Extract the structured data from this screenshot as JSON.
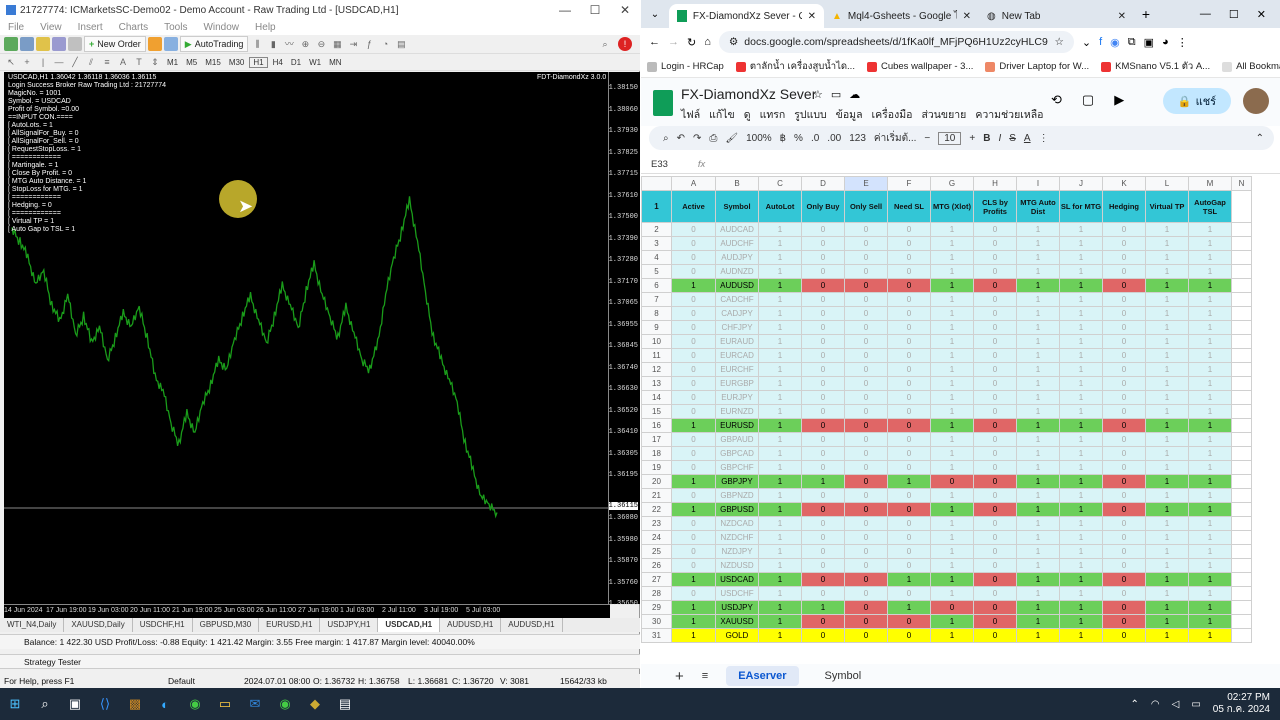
{
  "mt4": {
    "title": "21727774: ICMarketsSC-Demo02 - Demo Account - Raw Trading Ltd - [USDCAD,H1]",
    "menu": [
      "File",
      "View",
      "Insert",
      "Charts",
      "Tools",
      "Window",
      "Help"
    ],
    "toolbar": {
      "new_order": "New Order",
      "autotrading": "AutoTrading"
    },
    "timeframes": [
      "M1",
      "M5",
      "M15",
      "M30",
      "H1",
      "H4",
      "D1",
      "W1",
      "MN"
    ],
    "chart_header": "USDCAD,H1  1.36042 1.36118 1.36036 1.36115",
    "ea_name": "FDT-DiamondXz 3.0.0",
    "info_lines": [
      "Login Success Broker Raw Trading Ltd : 21727774",
      "MagicNo. = 1001",
      "Symbol. = USDCAD",
      "Profit of Symbol. =0.00",
      "==INPUT CON.====",
      "[ AutoLots. = 1",
      "[ AllSignalFor_Buy. = 0",
      "[ AllSignalFor_Sell. = 0",
      "[ RequestStopLoss. = 1",
      "[ ============",
      "[ Martingale. = 1",
      "[ Close By Profit. = 0",
      "[ MTG Auto Distance. = 1",
      "[ StopLoss for MTG. = 1",
      "[ ============",
      "[ Hedging. = 0",
      "[ ============",
      "[ Virtual TP = 1",
      "[ Auto Gap to TSL = 1"
    ],
    "price_labels": [
      "1.38150",
      "1.38060",
      "1.37930",
      "1.37825",
      "1.37715",
      "1.37610",
      "1.37500",
      "1.37390",
      "1.37280",
      "1.37170",
      "1.37065",
      "1.36955",
      "1.36845",
      "1.36740",
      "1.36630",
      "1.36520",
      "1.36410",
      "1.36305",
      "1.36195",
      "1.36115",
      "1.36080",
      "1.35980",
      "1.35870",
      "1.35760",
      "1.35650"
    ],
    "current_price": "1.36115",
    "time_labels": [
      "14 Jun 2024",
      "17 Jun 19:00",
      "19 Jun 03:00",
      "20 Jun 11:00",
      "21 Jun 19:00",
      "25 Jun 03:00",
      "26 Jun 11:00",
      "27 Jun 19:00",
      "1 Jul 03:00",
      "2 Jul 11:00",
      "3 Jul 19:00",
      "5 Jul 03:00"
    ],
    "chart_tabs": [
      "WTI_N4,Daily",
      "XAUUSD,Daily",
      "USDCHF,H1",
      "GBPUSD,M30",
      "EURUSD,H1",
      "USDJPY,H1",
      "USDCAD,H1",
      "AUDUSD,H1",
      "AUDUSD,H1"
    ],
    "active_tab": "USDCAD,H1",
    "terminal_line": "Balance: 1 422.30 USD  Profit/Loss: -0.88  Equity: 1 421.42  Margin: 3.55  Free margin: 1 417.87  Margin level: 40040.00%",
    "strategy_tester": "Strategy Tester",
    "status": {
      "help": "For Help, press F1",
      "profile": "Default",
      "datetime": "2024.07.01 08:00",
      "open": "O: 1.36732",
      "high": "H: 1.36758",
      "low": "L: 1.36681",
      "close": "C: 1.36720",
      "volume": "V: 3081",
      "traffic": "15642/33 kb"
    },
    "chart_series": [
      1.3742,
      1.3735,
      1.3728,
      1.3715,
      1.3722,
      1.3705,
      1.3698,
      1.371,
      1.3692,
      1.37,
      1.3688,
      1.3695,
      1.368,
      1.369,
      1.3702,
      1.3695,
      1.3705,
      1.369,
      1.3672,
      1.3665,
      1.365,
      1.364,
      1.3655,
      1.3645,
      1.366,
      1.3668,
      1.368,
      1.3675,
      1.369,
      1.37,
      1.371,
      1.3698,
      1.3688,
      1.37,
      1.3715,
      1.3705,
      1.3695,
      1.3712,
      1.3725,
      1.371,
      1.37,
      1.369,
      1.3705,
      1.3692,
      1.368,
      1.3675,
      1.3688,
      1.371,
      1.3728,
      1.374,
      1.3755,
      1.3735,
      1.3712,
      1.369,
      1.368,
      1.367,
      1.366,
      1.364,
      1.3628,
      1.3615,
      1.3612,
      1.3608
    ]
  },
  "chrome": {
    "tabs": [
      {
        "label": "FX-DiamondXz Sever - Google",
        "active": true
      },
      {
        "label": "Mql4-Gsheets - Google ไดรฟ์",
        "active": false
      },
      {
        "label": "New Tab",
        "active": false
      }
    ],
    "url": "docs.google.com/spreadsheets/d/1fKa0lf_MFjPQ6H1Uz2cyHLC9BH95VLTep...",
    "bookmarks": [
      "Login - HRCap",
      "ตาลักน้ำ เครื่องสูบน้ำได...",
      "Cubes wallpaper - 3...",
      "Driver Laptop for W...",
      "KMSnano V5.1 ตัว A...",
      "All Bookmarks"
    ],
    "doc_title": "FX-DiamondXz Sever",
    "doc_menu": [
      "ไฟล์",
      "แก้ไข",
      "ดู",
      "แทรก",
      "รูปแบบ",
      "ข้อมูล",
      "เครื่องมือ",
      "ส่วนขยาย",
      "ความช่วยเหลือ"
    ],
    "share": "แชร์",
    "zoom": "100%",
    "font": "ค่าเริ่มต้...",
    "font_size": "10",
    "cell_ref": "E33",
    "columns": [
      "A",
      "B",
      "C",
      "D",
      "E",
      "F",
      "G",
      "H",
      "I",
      "J",
      "K",
      "L",
      "M",
      "N"
    ],
    "headers": [
      "Active",
      "Symbol",
      "AutoLot",
      "Only Buy",
      "Only Sell",
      "Need SL",
      "MTG (Xlot)",
      "CLS by Profits",
      "MTG Auto Dist",
      "SL for MTG",
      "Hedging",
      "Virtual TP",
      "AutoGap TSL"
    ],
    "rows": [
      {
        "n": "2",
        "active": "0",
        "sym": "AUDCAD",
        "v": [
          "1",
          "0",
          "0",
          "0",
          "1",
          "0",
          "1",
          "1",
          "0",
          "1",
          "1"
        ]
      },
      {
        "n": "3",
        "active": "0",
        "sym": "AUDCHF",
        "v": [
          "1",
          "0",
          "0",
          "0",
          "1",
          "0",
          "1",
          "1",
          "0",
          "1",
          "1"
        ]
      },
      {
        "n": "4",
        "active": "0",
        "sym": "AUDJPY",
        "v": [
          "1",
          "0",
          "0",
          "0",
          "1",
          "0",
          "1",
          "1",
          "0",
          "1",
          "1"
        ]
      },
      {
        "n": "5",
        "active": "0",
        "sym": "AUDNZD",
        "v": [
          "1",
          "0",
          "0",
          "0",
          "1",
          "0",
          "1",
          "1",
          "0",
          "1",
          "1"
        ]
      },
      {
        "n": "6",
        "active": "1",
        "sym": "AUDUSD",
        "v": [
          "1",
          "0",
          "0",
          "0",
          "1",
          "0",
          "1",
          "1",
          "0",
          "1",
          "1"
        ]
      },
      {
        "n": "7",
        "active": "0",
        "sym": "CADCHF",
        "v": [
          "1",
          "0",
          "0",
          "0",
          "1",
          "0",
          "1",
          "1",
          "0",
          "1",
          "1"
        ]
      },
      {
        "n": "8",
        "active": "0",
        "sym": "CADJPY",
        "v": [
          "1",
          "0",
          "0",
          "0",
          "1",
          "0",
          "1",
          "1",
          "0",
          "1",
          "1"
        ]
      },
      {
        "n": "9",
        "active": "0",
        "sym": "CHFJPY",
        "v": [
          "1",
          "0",
          "0",
          "0",
          "1",
          "0",
          "1",
          "1",
          "0",
          "1",
          "1"
        ]
      },
      {
        "n": "10",
        "active": "0",
        "sym": "EURAUD",
        "v": [
          "1",
          "0",
          "0",
          "0",
          "1",
          "0",
          "1",
          "1",
          "0",
          "1",
          "1"
        ]
      },
      {
        "n": "11",
        "active": "0",
        "sym": "EURCAD",
        "v": [
          "1",
          "0",
          "0",
          "0",
          "1",
          "0",
          "1",
          "1",
          "0",
          "1",
          "1"
        ]
      },
      {
        "n": "12",
        "active": "0",
        "sym": "EURCHF",
        "v": [
          "1",
          "0",
          "0",
          "0",
          "1",
          "0",
          "1",
          "1",
          "0",
          "1",
          "1"
        ]
      },
      {
        "n": "13",
        "active": "0",
        "sym": "EURGBP",
        "v": [
          "1",
          "0",
          "0",
          "0",
          "1",
          "0",
          "1",
          "1",
          "0",
          "1",
          "1"
        ]
      },
      {
        "n": "14",
        "active": "0",
        "sym": "EURJPY",
        "v": [
          "1",
          "0",
          "0",
          "0",
          "1",
          "0",
          "1",
          "1",
          "0",
          "1",
          "1"
        ]
      },
      {
        "n": "15",
        "active": "0",
        "sym": "EURNZD",
        "v": [
          "1",
          "0",
          "0",
          "0",
          "1",
          "0",
          "1",
          "1",
          "0",
          "1",
          "1"
        ]
      },
      {
        "n": "16",
        "active": "1",
        "sym": "EURUSD",
        "v": [
          "1",
          "0",
          "0",
          "0",
          "1",
          "0",
          "1",
          "1",
          "0",
          "1",
          "1"
        ]
      },
      {
        "n": "17",
        "active": "0",
        "sym": "GBPAUD",
        "v": [
          "1",
          "0",
          "0",
          "0",
          "1",
          "0",
          "1",
          "1",
          "0",
          "1",
          "1"
        ]
      },
      {
        "n": "18",
        "active": "0",
        "sym": "GBPCAD",
        "v": [
          "1",
          "0",
          "0",
          "0",
          "1",
          "0",
          "1",
          "1",
          "0",
          "1",
          "1"
        ]
      },
      {
        "n": "19",
        "active": "0",
        "sym": "GBPCHF",
        "v": [
          "1",
          "0",
          "0",
          "0",
          "1",
          "0",
          "1",
          "1",
          "0",
          "1",
          "1"
        ]
      },
      {
        "n": "20",
        "active": "1",
        "sym": "GBPJPY",
        "v": [
          "1",
          "1",
          "0",
          "1",
          "0",
          "0",
          "1",
          "1",
          "0",
          "1",
          "1"
        ]
      },
      {
        "n": "21",
        "active": "0",
        "sym": "GBPNZD",
        "v": [
          "1",
          "0",
          "0",
          "0",
          "1",
          "0",
          "1",
          "1",
          "0",
          "1",
          "1"
        ]
      },
      {
        "n": "22",
        "active": "1",
        "sym": "GBPUSD",
        "v": [
          "1",
          "0",
          "0",
          "0",
          "1",
          "0",
          "1",
          "1",
          "0",
          "1",
          "1"
        ]
      },
      {
        "n": "23",
        "active": "0",
        "sym": "NZDCAD",
        "v": [
          "1",
          "0",
          "0",
          "0",
          "1",
          "0",
          "1",
          "1",
          "0",
          "1",
          "1"
        ]
      },
      {
        "n": "24",
        "active": "0",
        "sym": "NZDCHF",
        "v": [
          "1",
          "0",
          "0",
          "0",
          "1",
          "0",
          "1",
          "1",
          "0",
          "1",
          "1"
        ]
      },
      {
        "n": "25",
        "active": "0",
        "sym": "NZDJPY",
        "v": [
          "1",
          "0",
          "0",
          "0",
          "1",
          "0",
          "1",
          "1",
          "0",
          "1",
          "1"
        ]
      },
      {
        "n": "26",
        "active": "0",
        "sym": "NZDUSD",
        "v": [
          "1",
          "0",
          "0",
          "0",
          "1",
          "0",
          "1",
          "1",
          "0",
          "1",
          "1"
        ]
      },
      {
        "n": "27",
        "active": "1",
        "sym": "USDCAD",
        "v": [
          "1",
          "0",
          "0",
          "1",
          "1",
          "0",
          "1",
          "1",
          "0",
          "1",
          "1"
        ]
      },
      {
        "n": "28",
        "active": "0",
        "sym": "USDCHF",
        "v": [
          "1",
          "0",
          "0",
          "0",
          "1",
          "0",
          "1",
          "1",
          "0",
          "1",
          "1"
        ]
      },
      {
        "n": "29",
        "active": "1",
        "sym": "USDJPY",
        "v": [
          "1",
          "1",
          "0",
          "1",
          "0",
          "0",
          "1",
          "1",
          "0",
          "1",
          "1"
        ]
      },
      {
        "n": "30",
        "active": "1",
        "sym": "XAUUSD",
        "v": [
          "1",
          "0",
          "0",
          "0",
          "1",
          "0",
          "1",
          "1",
          "0",
          "1",
          "1"
        ]
      },
      {
        "n": "31",
        "active": "1",
        "sym": "GOLD",
        "v": [
          "1",
          "0",
          "0",
          "0",
          "1",
          "0",
          "1",
          "1",
          "0",
          "1",
          "1"
        ],
        "gold": true
      }
    ],
    "sheet_tabs": [
      "EAserver",
      "Symbol"
    ],
    "active_sheet": "EAserver"
  },
  "taskbar": {
    "time": "02:27 PM",
    "date": "05 ก.ค. 2024"
  },
  "colors": {
    "chart_line": "#1a9c1a",
    "cyan_header": "#33c6d6",
    "green": "#6ccf5a",
    "red": "#e06666",
    "light": "#d9f4f7",
    "gold": "#ffff00"
  }
}
